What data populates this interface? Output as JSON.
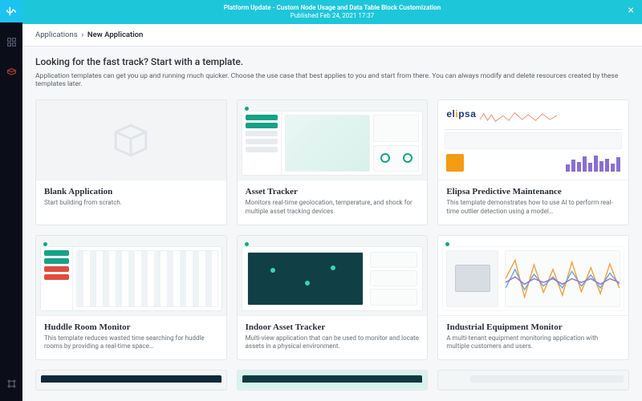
{
  "banner": {
    "title": "Platform Update - Custom Node Usage and Data Table Block Customization",
    "subtitle": "Published Feb 24, 2021 17:37"
  },
  "breadcrumbs": {
    "root": "Applications",
    "current": "New Application"
  },
  "page": {
    "heading": "Looking for the fast track? Start with a template.",
    "sub": "Application templates can get you up and running much quicker. Choose the use case that best applies to you and start from there. You can always modify and delete resources created by these templates later."
  },
  "templates": [
    {
      "title": "Blank Application",
      "desc": "Start building from scratch."
    },
    {
      "title": "Asset Tracker",
      "desc": "Monitors real-time geolocation, temperature, and shock for multiple asset tracking devices."
    },
    {
      "title": "Elipsa Predictive Maintenance",
      "desc": "This template demonstrates how to use AI to perform real-time outlier detection using a model…"
    },
    {
      "title": "Huddle Room Monitor",
      "desc": "This template reduces wasted time searching for huddle rooms by providing a real-time space…"
    },
    {
      "title": "Indoor Asset Tracker",
      "desc": "Multi-view application that can be used to monitor and locate assets in a physical environment."
    },
    {
      "title": "Industrial Equipment Monitor",
      "desc": "A multi-tenant equipment monitoring application with multiple customers and users."
    }
  ],
  "sidebar": {
    "items": [
      "logo",
      "dashboards",
      "devices"
    ],
    "bottom": "settings"
  }
}
